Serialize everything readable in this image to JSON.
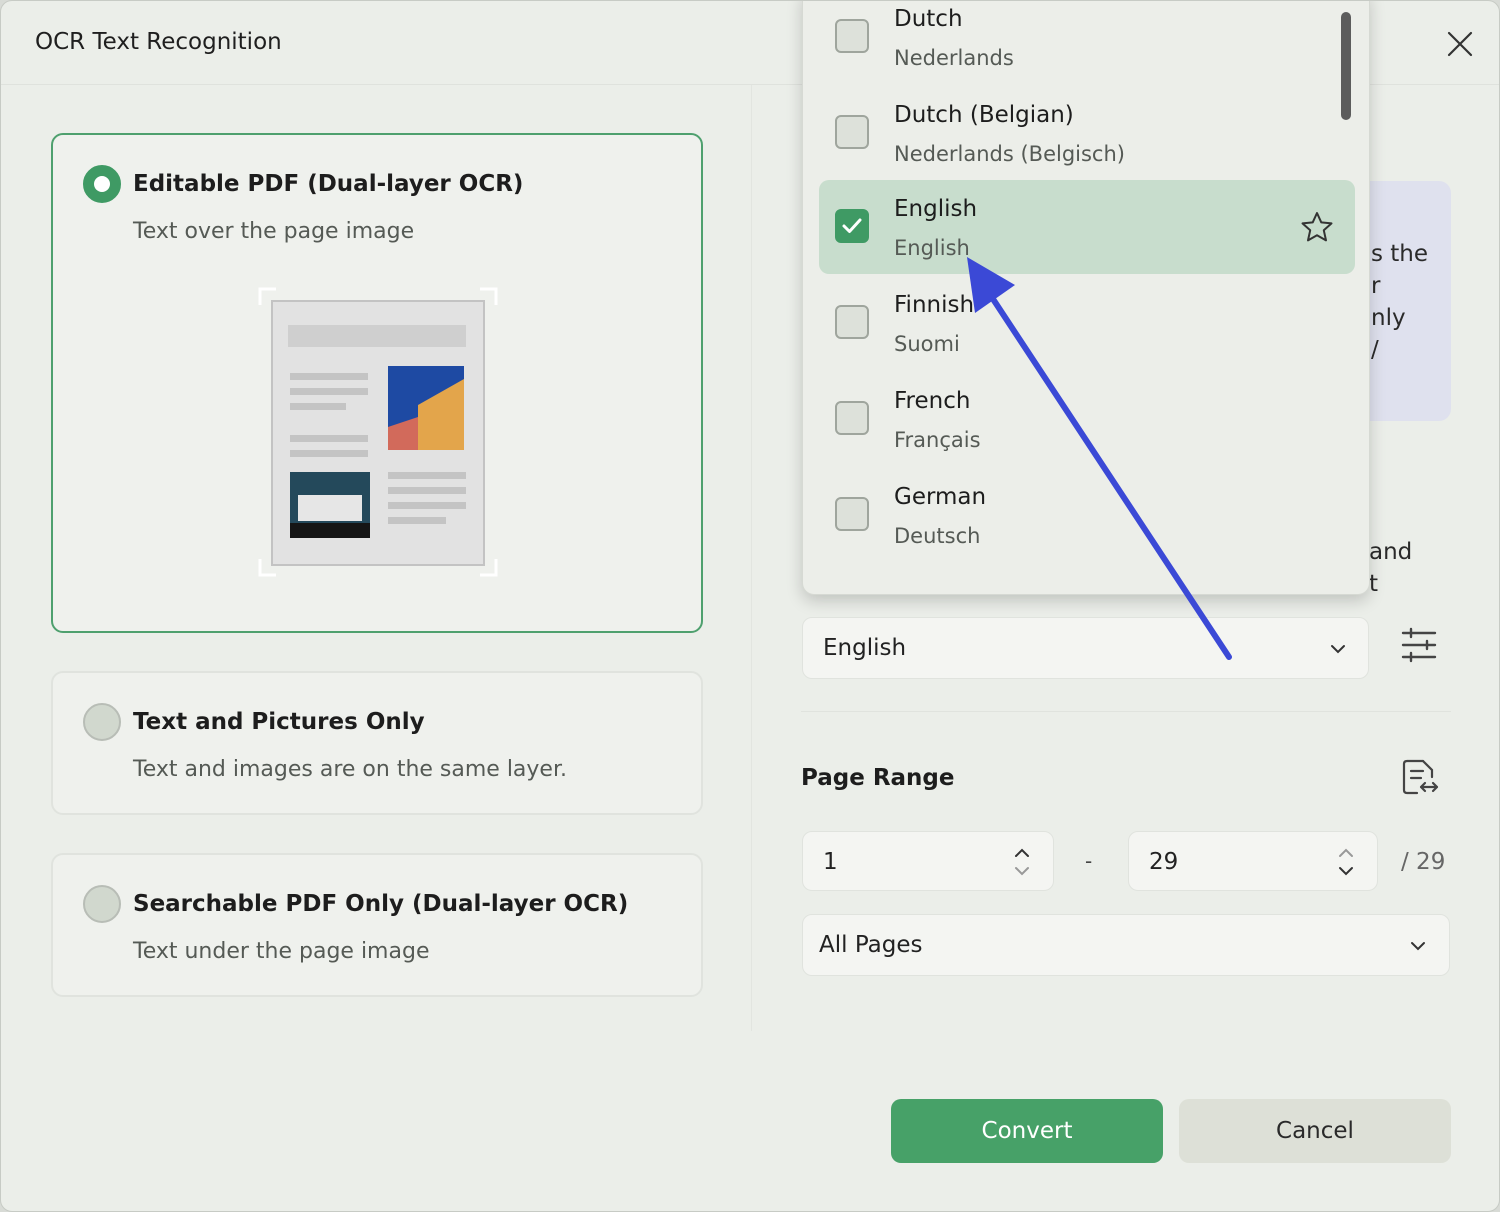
{
  "dialog": {
    "title": "OCR Text Recognition"
  },
  "options": [
    {
      "title": "Editable PDF (Dual-layer OCR)",
      "desc": "Text over the page image",
      "selected": true
    },
    {
      "title": "Text and Pictures Only",
      "desc": "Text and images are on the same layer.",
      "selected": false
    },
    {
      "title": "Searchable PDF Only (Dual-layer OCR)",
      "desc": "Text under the page image",
      "selected": false
    }
  ],
  "info_box_fragments": [
    "s the",
    "r",
    "nly",
    "/"
  ],
  "partial_text_fragments": [
    "and",
    "t"
  ],
  "language": {
    "selected": "English",
    "dropdown": [
      {
        "name": "Dutch",
        "native": "Nederlands",
        "checked": false
      },
      {
        "name": "Dutch (Belgian)",
        "native": "Nederlands (Belgisch)",
        "checked": false
      },
      {
        "name": "English",
        "native": "English",
        "checked": true
      },
      {
        "name": "Finnish",
        "native": "Suomi",
        "checked": false
      },
      {
        "name": "French",
        "native": "Français",
        "checked": false
      },
      {
        "name": "German",
        "native": "Deutsch",
        "checked": false
      }
    ]
  },
  "page_range": {
    "title": "Page Range",
    "from": "1",
    "to": "29",
    "separator": "-",
    "total": "/ 29",
    "scope": "All Pages"
  },
  "buttons": {
    "convert": "Convert",
    "cancel": "Cancel"
  },
  "colors": {
    "accent": "#47a168",
    "arrow": "#3b49d6",
    "selected_row": "#c8ddcd"
  },
  "icons": [
    "close-icon",
    "chevron-down-icon",
    "sliders-icon",
    "page-range-icon",
    "chevron-up-icon",
    "star-icon",
    "check-icon",
    "annotation-arrow"
  ]
}
